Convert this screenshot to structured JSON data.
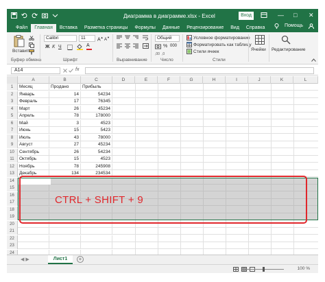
{
  "window": {
    "title": "Диаграмма в диаграмме.xlsx  -  Excel",
    "login_button": "Вход",
    "restore_icon": "restore-icon",
    "minimize_glyph": "—",
    "maximize_glyph": "□",
    "close_glyph": "✕"
  },
  "tabs": [
    "Файл",
    "Главная",
    "Вставка",
    "Разметка страницы",
    "Формулы",
    "Данные",
    "Рецензирование",
    "Вид",
    "Справка"
  ],
  "tabs_right": {
    "tell_me": "Помощь",
    "share": "Помощ"
  },
  "ribbon": {
    "paste": "Вставить",
    "clipboard": "Буфер обмена",
    "font_name": "Calibri",
    "font_size": "11",
    "font_group": "Шрифт",
    "align_group": "Выравнивание",
    "number_format": "Общий",
    "number_group": "Число",
    "cond_format": "Условное форматирование",
    "format_table": "Форматировать как таблицу",
    "cell_styles": "Стили ячеек",
    "styles_group": "Стили",
    "cells_btn": "Ячейки",
    "editing_btn": "Редактирование",
    "bold": "Ж",
    "italic": "К",
    "underline": "Ч",
    "percent": "%"
  },
  "formula_bar": {
    "name_box": "A14",
    "fx": "fx",
    "value": ""
  },
  "columns": [
    "A",
    "B",
    "C",
    "D",
    "E",
    "F",
    "G",
    "H",
    "I",
    "J",
    "K",
    "L"
  ],
  "headers": {
    "month": "Месяц",
    "sold": "Продано",
    "profit": "Прибыль"
  },
  "rows": [
    {
      "n": "1",
      "a": "Месяц",
      "b": "Продано",
      "c": "Прибыль"
    },
    {
      "n": "2",
      "a": "Январь",
      "b": "14",
      "c": "54234"
    },
    {
      "n": "3",
      "a": "Февраль",
      "b": "17",
      "c": "76345"
    },
    {
      "n": "4",
      "a": "Март",
      "b": "26",
      "c": "45234"
    },
    {
      "n": "5",
      "a": "Апрель",
      "b": "78",
      "c": "178000"
    },
    {
      "n": "6",
      "a": "Май",
      "b": "3",
      "c": "4523"
    },
    {
      "n": "7",
      "a": "Июнь",
      "b": "15",
      "c": "5423"
    },
    {
      "n": "8",
      "a": "Июль",
      "b": "43",
      "c": "78000"
    },
    {
      "n": "9",
      "a": "Август",
      "b": "27",
      "c": "45234"
    },
    {
      "n": "10",
      "a": "Сентябрь",
      "b": "26",
      "c": "54234"
    },
    {
      "n": "11",
      "a": "Октябрь",
      "b": "15",
      "c": "4523"
    },
    {
      "n": "12",
      "a": "Ноябрь",
      "b": "78",
      "c": "245908"
    },
    {
      "n": "13",
      "a": "Декабрь",
      "b": "134",
      "c": "234534"
    },
    {
      "n": "14",
      "a": "",
      "b": "",
      "c": ""
    },
    {
      "n": "15",
      "a": "",
      "b": "",
      "c": ""
    },
    {
      "n": "16",
      "a": "",
      "b": "",
      "c": ""
    },
    {
      "n": "17",
      "a": "",
      "b": "",
      "c": ""
    },
    {
      "n": "18",
      "a": "",
      "b": "",
      "c": ""
    },
    {
      "n": "19",
      "a": "",
      "b": "",
      "c": ""
    },
    {
      "n": "20",
      "a": "",
      "b": "",
      "c": ""
    },
    {
      "n": "21",
      "a": "",
      "b": "",
      "c": ""
    },
    {
      "n": "22",
      "a": "",
      "b": "",
      "c": ""
    },
    {
      "n": "23",
      "a": "",
      "b": "",
      "c": ""
    },
    {
      "n": "24",
      "a": "",
      "b": "",
      "c": ""
    }
  ],
  "annotation": {
    "text": "CTRL + SHIFT + 9",
    "color": "#e0262b"
  },
  "sheet": {
    "tab": "Лист1",
    "add": "+",
    "nav": "◀ ▶"
  },
  "status": {
    "zoom": "100 %"
  },
  "colors": {
    "accent": "#217346"
  }
}
